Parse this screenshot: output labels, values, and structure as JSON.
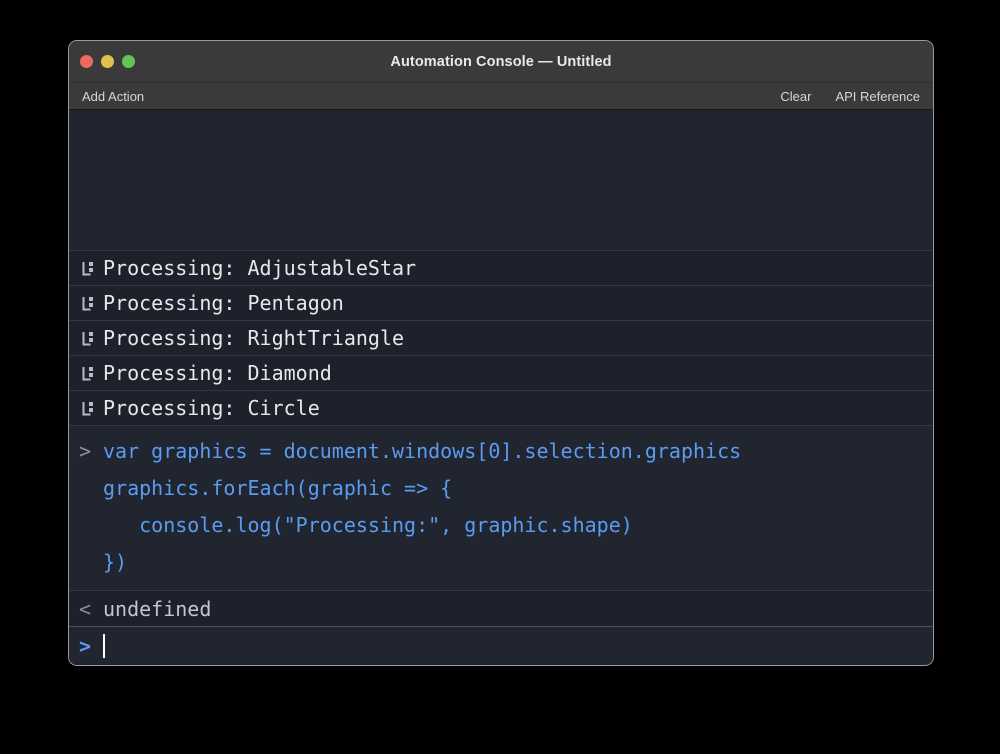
{
  "window": {
    "title": "Automation Console — Untitled",
    "traffic_lights": [
      {
        "name": "close",
        "color": "#ec6a5e"
      },
      {
        "name": "minimize",
        "color": "#e1c14e"
      },
      {
        "name": "maximize",
        "color": "#61c454"
      }
    ]
  },
  "toolbar": {
    "left": [
      {
        "label": "Add Action"
      }
    ],
    "right": [
      {
        "label": "Clear"
      },
      {
        "label": "API Reference"
      }
    ]
  },
  "console": {
    "log_rows": [
      {
        "icon": "log-output-icon",
        "text": "Processing: AdjustableStar"
      },
      {
        "icon": "log-output-icon",
        "text": "Processing: Pentagon"
      },
      {
        "icon": "log-output-icon",
        "text": "Processing: RightTriangle"
      },
      {
        "icon": "log-output-icon",
        "text": "Processing: Diamond"
      },
      {
        "icon": "log-output-icon",
        "text": "Processing: Circle"
      }
    ],
    "code_entry": {
      "prompt": ">",
      "lines": [
        "var graphics = document.windows[0].selection.graphics",
        "graphics.forEach(graphic => {",
        "   console.log(\"Processing:\", graphic.shape)",
        "})"
      ]
    },
    "result": {
      "prompt": "<",
      "text": "undefined"
    },
    "input": {
      "prompt": ">",
      "value": "",
      "placeholder": ""
    }
  },
  "colors": {
    "page_background": "#000000",
    "window_background": "#212530",
    "titlebar": "#3a3a3a",
    "row_background": "#1d212b",
    "row_separator": "#333848",
    "code_text": "#5b9bf0",
    "log_text": "#e8e8e8",
    "muted_text": "#8b8f98",
    "result_text": "#c3c7cc",
    "window_border": "#9a9a9a"
  }
}
